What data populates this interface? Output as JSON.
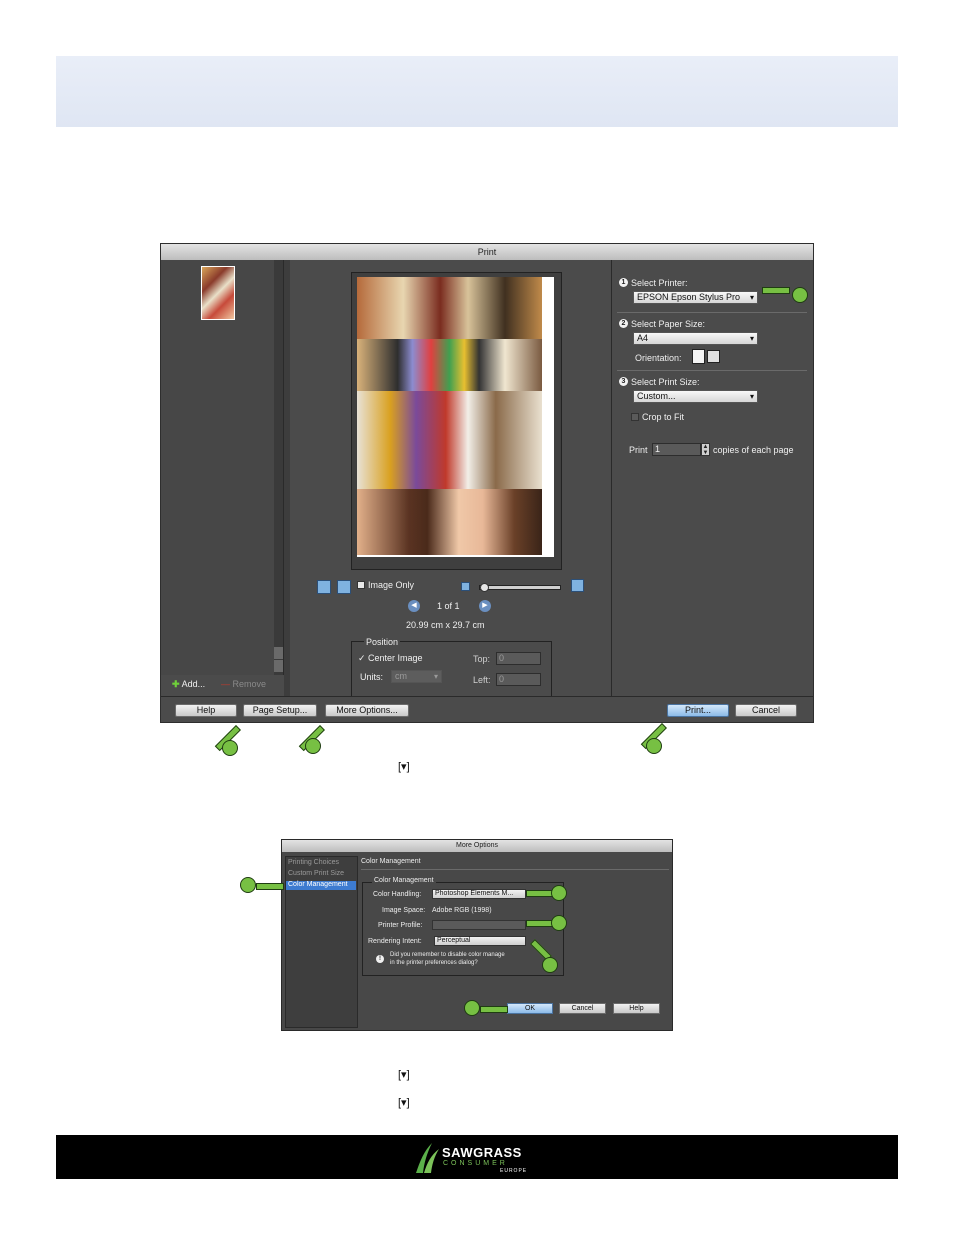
{
  "print_dialog": {
    "title": "Print",
    "add_label": "Add...",
    "remove_label": "Remove",
    "step1_label": "Select Printer:",
    "printer_value": "EPSON Epson Stylus Pro",
    "step2_label": "Select Paper Size:",
    "paper_value": "A4",
    "orientation_label": "Orientation:",
    "step3_label": "Select Print Size:",
    "print_size_value": "Custom...",
    "crop_label": "Crop to Fit",
    "copies_prefix": "Print",
    "copies_value": "1",
    "copies_suffix": "copies of each page",
    "image_only_label": "Image Only",
    "page_indicator": "1 of 1",
    "dimensions": "20.99 cm x 29.7 cm",
    "position_label": "Position",
    "center_image_label": "Center Image",
    "top_label": "Top:",
    "top_value": "0",
    "units_label": "Units:",
    "units_value": "cm",
    "left_label": "Left:",
    "left_value": "0",
    "help_label": "Help",
    "page_setup_label": "Page Setup...",
    "more_options_label": "More Options...",
    "print_label": "Print...",
    "cancel_label": "Cancel",
    "step_numbers": [
      "1",
      "2",
      "3"
    ]
  },
  "more_options": {
    "title": "More Options",
    "sidebar_items": [
      "Printing Choices",
      "Custom Print Size",
      "Color Management"
    ],
    "section_title": "Color Management",
    "group_label": "Color Management",
    "color_handling_label": "Color Handling:",
    "color_handling_value": "Photoshop Elements M...",
    "image_space_label": "Image Space:",
    "image_space_value": "Adobe RGB (1998)",
    "printer_profile_label": "Printer Profile:",
    "printer_profile_value": "",
    "rendering_intent_label": "Rendering Intent:",
    "rendering_intent_value": "Perceptual",
    "note_line1": "Did you remember to disable color manage",
    "note_line2": "in the printer preferences dialog?",
    "ok_label": "OK",
    "cancel_label": "Cancel",
    "help_label": "Help"
  },
  "doc_marks": {
    "mark1": "[▾]",
    "mark2": "[▾]",
    "mark3": "[▾]"
  },
  "footer": {
    "brand": "SAWGRASS",
    "brand_sub": "CONSUMER",
    "brand_region": "EUROPE",
    "logo_color": "#5bb04a"
  },
  "colors": {
    "dialog_bg": "#4b4b4b",
    "callout_green": "#77c043",
    "header_band": "#e4eaf5"
  }
}
